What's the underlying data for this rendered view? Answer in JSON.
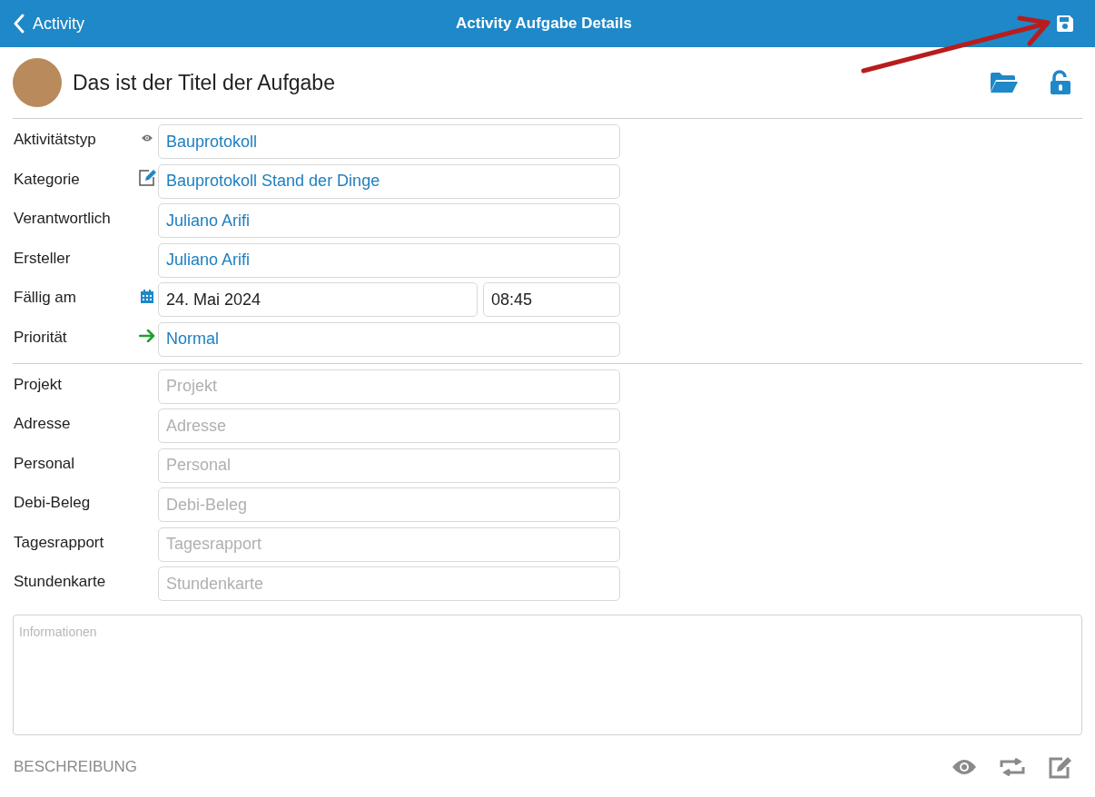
{
  "nav": {
    "back_label": "Activity",
    "title": "Activity Aufgabe Details"
  },
  "task": {
    "title": "Das ist der Titel der Aufgabe"
  },
  "details": [
    {
      "label": "Aktivitätstyp",
      "kind": "select",
      "value": "Bauprotokoll"
    },
    {
      "label": "Kategorie",
      "kind": "select",
      "value": "Bauprotokoll Stand der Dinge"
    },
    {
      "label": "Verantwortlich",
      "kind": "select",
      "value": "Juliano Arifi"
    },
    {
      "label": "Ersteller",
      "kind": "select",
      "value": "Juliano Arifi"
    },
    {
      "label": "Fällig am",
      "kind": "datetime",
      "date": "24. Mai 2024",
      "time": "08:45"
    },
    {
      "label": "Priorität",
      "kind": "select",
      "value": "Normal"
    }
  ],
  "links": [
    {
      "label": "Projekt",
      "placeholder": "Projekt"
    },
    {
      "label": "Adresse",
      "placeholder": "Adresse"
    },
    {
      "label": "Personal",
      "placeholder": "Personal"
    },
    {
      "label": "Debi-Beleg",
      "placeholder": "Debi-Beleg"
    },
    {
      "label": "Tagesrapport",
      "placeholder": "Tagesrapport"
    },
    {
      "label": "Stundenkarte",
      "placeholder": "Stundenkarte"
    }
  ],
  "informationen": {
    "placeholder": "Informationen"
  },
  "footer": {
    "label": "BESCHREIBUNG"
  }
}
